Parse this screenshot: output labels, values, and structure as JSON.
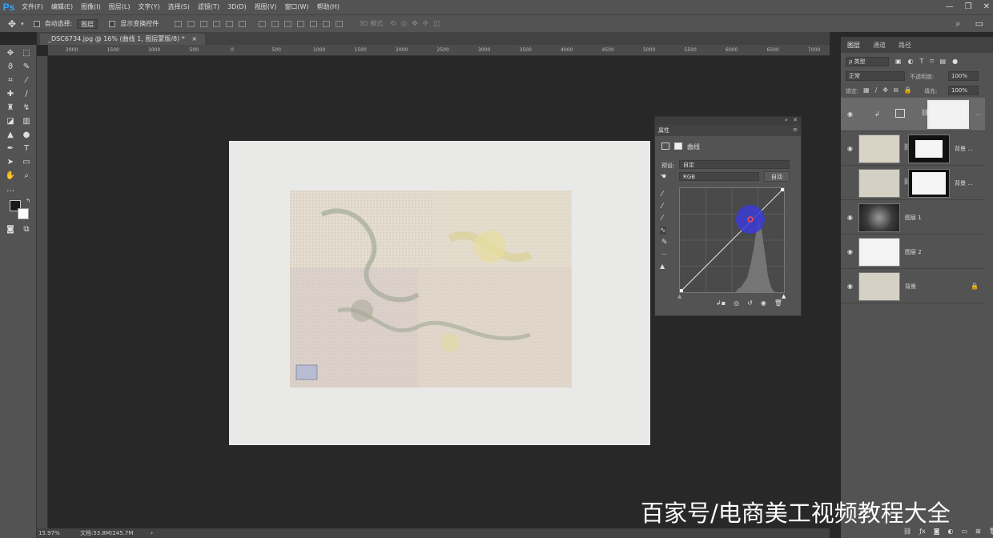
{
  "app": {
    "logo": "Ps"
  },
  "menu": [
    "文件(F)",
    "编辑(E)",
    "图像(I)",
    "图层(L)",
    "文字(Y)",
    "选择(S)",
    "滤镜(T)",
    "3D(D)",
    "视图(V)",
    "窗口(W)",
    "帮助(H)"
  ],
  "window_controls": {
    "minimize": "—",
    "restore": "❐",
    "close": "✕"
  },
  "options": {
    "auto_select_label": "自动选择:",
    "auto_select_value": "图层",
    "show_transform_label": "显示变换控件",
    "mode_3d_label": "3D 模式:"
  },
  "document": {
    "tab_title": "_DSC6734.jpg @ 16% (曲线 1, 图层蒙版/8) *",
    "close": "×",
    "zoom": "15.97%",
    "doc_size": "文档:53.8M/245.7M"
  },
  "ruler_h": [
    "2000",
    "1500",
    "1000",
    "500",
    "0",
    "500",
    "1000",
    "1500",
    "2000",
    "2500",
    "3000",
    "3500",
    "4000",
    "4500",
    "5000",
    "5500",
    "6000",
    "6500",
    "7000"
  ],
  "properties": {
    "tab": "属性",
    "type_label": "曲线",
    "preset_label": "预设:",
    "preset_value": "自定",
    "channel_value": "RGB",
    "auto_button": "自动"
  },
  "layers_panel": {
    "tabs": [
      "图层",
      "通道",
      "路径"
    ],
    "filter_label": "ρ 类型",
    "blend_mode": "正常",
    "opacity_label": "不透明度:",
    "opacity_value": "100%",
    "lock_label": "锁定:",
    "fill_label": "填充:",
    "fill_value": "100%",
    "layers": [
      {
        "name": "背景 ..."
      },
      {
        "name": "背景 ..."
      },
      {
        "name": "图层 1"
      },
      {
        "name": "图层 2"
      },
      {
        "name": "背景"
      }
    ]
  },
  "watermark": "百家号/电商美工视频教程大全",
  "colors": {
    "chrome": "#535353",
    "canvas": "#282828",
    "accent": "#31a8ff",
    "curve_point_halo": "#3b3bd6"
  }
}
